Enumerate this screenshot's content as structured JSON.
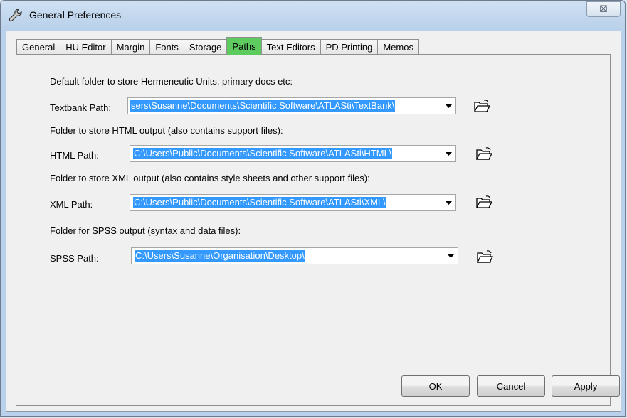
{
  "window": {
    "title": "General Preferences",
    "close_glyph": "☒"
  },
  "tabs": [
    {
      "label": "General"
    },
    {
      "label": "HU Editor"
    },
    {
      "label": "Margin"
    },
    {
      "label": "Fonts"
    },
    {
      "label": "Storage"
    },
    {
      "label": "Paths",
      "active": true
    },
    {
      "label": "Text Editors"
    },
    {
      "label": "PD Printing"
    },
    {
      "label": "Memos"
    }
  ],
  "paths": {
    "textbank": {
      "heading": "Default folder to store Hermeneutic Units, primary docs etc:",
      "label": "Textbank Path:",
      "value": "sers\\Susanne\\Documents\\Scientific Software\\ATLASti\\TextBank\\"
    },
    "html": {
      "heading": "Folder to store HTML output (also contains support files):",
      "label": "HTML Path:",
      "value": "C:\\Users\\Public\\Documents\\Scientific Software\\ATLASti\\HTML\\"
    },
    "xml": {
      "heading": "Folder to store XML output (also contains style sheets and other support files):",
      "label": "XML Path:",
      "value": "C:\\Users\\Public\\Documents\\Scientific Software\\ATLASti\\XML\\"
    },
    "spss": {
      "heading": "Folder for SPSS output (syntax and data files):",
      "label": "SPSS Path:",
      "value": "C:\\Users\\Susanne\\Organisation\\Desktop\\"
    }
  },
  "buttons": {
    "ok": "OK",
    "cancel": "Cancel",
    "apply": "Apply"
  },
  "icons": {
    "title": "wrench-icon",
    "browse": "open-folder-icon",
    "dropdown": "dropdown-arrow-icon"
  },
  "colors": {
    "active_tab": "#5ecb5e",
    "selection": "#3399ff"
  }
}
